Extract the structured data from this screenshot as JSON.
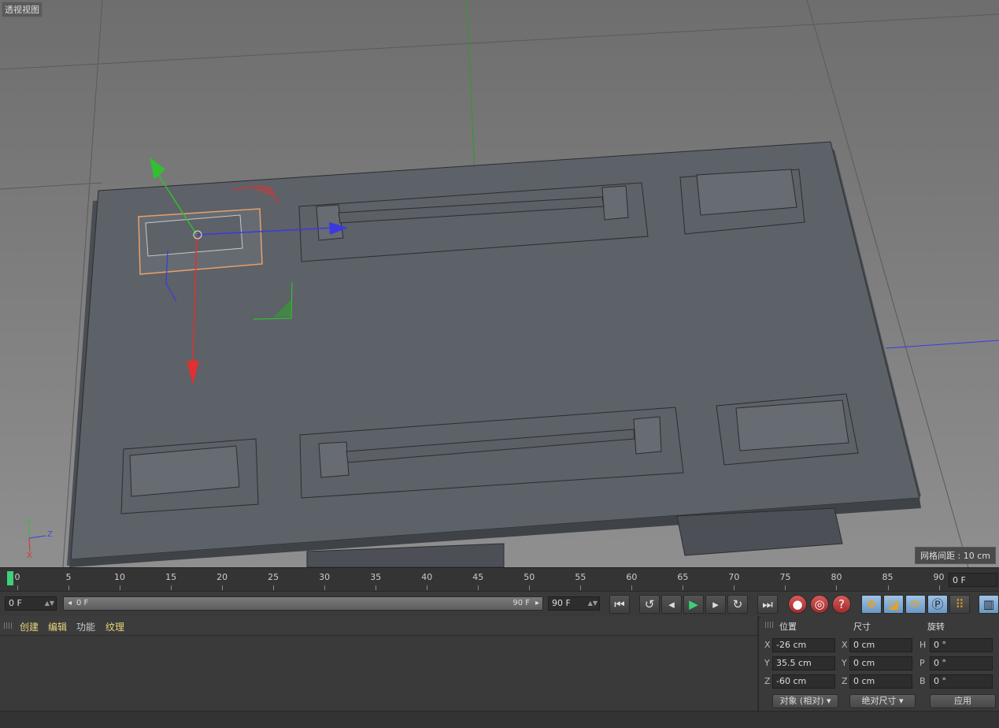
{
  "viewport": {
    "label": "透视视图",
    "grid_info": "网格间距 : 10 cm",
    "axis_labels": {
      "y": "Y",
      "z": "Z",
      "x": "X"
    }
  },
  "timeline": {
    "ticks": [
      "0",
      "5",
      "10",
      "15",
      "20",
      "25",
      "30",
      "35",
      "40",
      "45",
      "50",
      "55",
      "60",
      "65",
      "70",
      "75",
      "80",
      "85",
      "90"
    ],
    "current_frame": "0 F"
  },
  "transport": {
    "start_field": "0 F",
    "slider_left": "0 F",
    "slider_right": "90 F",
    "end_field": "90 F"
  },
  "materials": {
    "menu": [
      "创建",
      "编辑",
      "功能",
      "纹理"
    ]
  },
  "coords": {
    "headers": {
      "position": "位置",
      "size": "尺寸",
      "rotation": "旋转"
    },
    "position": {
      "x": "-26 cm",
      "y": "35.5 cm",
      "z": "-60 cm"
    },
    "size": {
      "x": "0 cm",
      "y": "0 cm",
      "z": "0 cm"
    },
    "rotation": {
      "h": "0 °",
      "p": "0 °",
      "b": "0 °"
    },
    "axis_letters": {
      "x": "X",
      "y": "Y",
      "z": "Z",
      "h": "H",
      "p": "P",
      "b": "B"
    },
    "mode_dropdown": "对象 (相对)",
    "size_dropdown": "绝对尺寸",
    "apply_button": "应用"
  },
  "colors": {
    "viewport_bg_top": "#6f6f6f",
    "viewport_bg_bottom": "#8e8e8e",
    "object_fill": "#5d6168",
    "highlight_orange": "#e6a06a"
  }
}
